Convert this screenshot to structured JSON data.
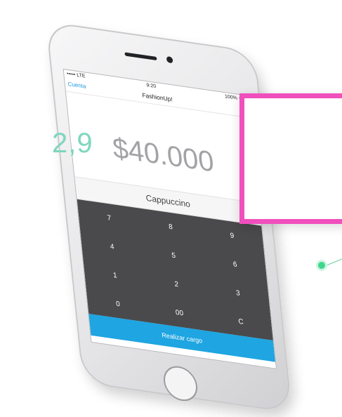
{
  "status_bar": {
    "carrier": "••••• LTE",
    "time": "9:20",
    "battery": "100%"
  },
  "nav": {
    "back_label": "Cuenta",
    "title": "FashionUp!"
  },
  "charge": {
    "amount": "$40.000",
    "item_name": "Cappuccino",
    "button_label": "Realizar cargo"
  },
  "keypad": {
    "keys": [
      "7",
      "8",
      "9",
      "4",
      "5",
      "6",
      "1",
      "2",
      "3",
      "0",
      "00",
      "C"
    ]
  },
  "callout": {
    "value": "2,9"
  },
  "colors": {
    "accent": "#1ea5e2",
    "callout_border": "#f04fbd",
    "callout_text": "#7fd6bd",
    "keypad_bg": "#4a4a4c",
    "connector": "#3fd68c"
  }
}
